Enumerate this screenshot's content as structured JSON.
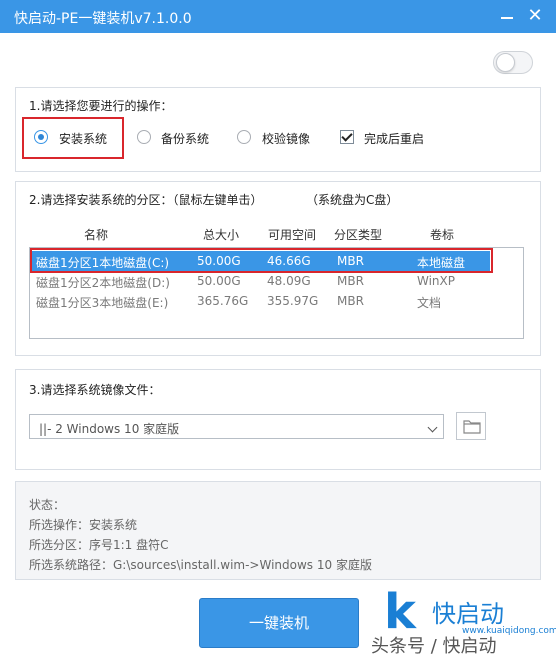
{
  "window": {
    "title": "快启动-PE一键装机v7.1.0.0"
  },
  "section1": {
    "title": "1.请选择您要进行的操作：",
    "options": [
      {
        "label": "安装系统",
        "selected": true
      },
      {
        "label": "备份系统",
        "selected": false
      },
      {
        "label": "校验镜像",
        "selected": false
      }
    ],
    "reboot_label": "完成后重启",
    "reboot_checked": true
  },
  "section2": {
    "title": "2.请选择安装系统的分区：（鼠标左键单击）",
    "note": "（系统盘为C盘）",
    "columns": [
      "名称",
      "总大小",
      "可用空间",
      "分区类型",
      "卷标"
    ],
    "rows": [
      {
        "name": "磁盘1分区1本地磁盘(C:)",
        "total": "50.00G",
        "free": "46.66G",
        "type": "MBR",
        "label": "本地磁盘",
        "selected": true
      },
      {
        "name": "磁盘1分区2本地磁盘(D:)",
        "total": "50.00G",
        "free": "48.09G",
        "type": "MBR",
        "label": "WinXP",
        "selected": false
      },
      {
        "name": "磁盘1分区3本地磁盘(E:)",
        "total": "365.76G",
        "free": "355.97G",
        "type": "MBR",
        "label": "文档",
        "selected": false
      }
    ]
  },
  "section3": {
    "title": "3.请选择系统镜像文件：",
    "selected_image": "||- 2 Windows  10 家庭版"
  },
  "status": {
    "title": "状态：",
    "operation": "所选操作：安装系统",
    "partition": "所选分区：序号1:1    盘符C",
    "path": "所选系统路径：G:\\sources\\install.wim->Windows  10 家庭版"
  },
  "action_button_label": "一键装机",
  "brand": {
    "logo_letter": "k",
    "name": "快启动",
    "url": "www.kuaiqidong.com",
    "watermark": "头条号 / 快启动"
  },
  "colors": {
    "accent": "#3a96e6",
    "highlight_box": "#d9262c"
  }
}
